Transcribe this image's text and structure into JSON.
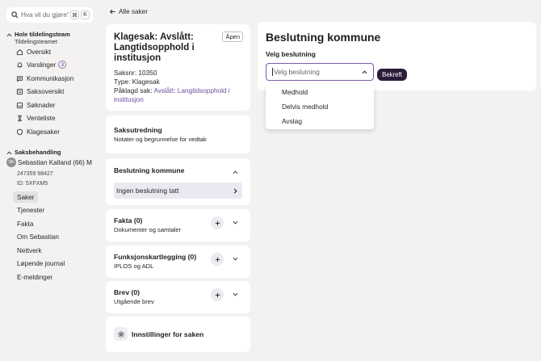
{
  "search": {
    "placeholder": "Hva vil du gjøre?",
    "key1": "⌘",
    "key2": "K"
  },
  "team": {
    "title": "Hole tildelingsteam",
    "subtitle": "Tildelingsteamet",
    "items": [
      {
        "label": "Oversikt",
        "icon": "home-icon"
      },
      {
        "label": "Varslinger",
        "icon": "bell-icon",
        "badge": "3"
      },
      {
        "label": "Kommunikasjon",
        "icon": "chat-icon"
      },
      {
        "label": "Saksoversikt",
        "icon": "list-icon"
      },
      {
        "label": "Søknader",
        "icon": "inbox-icon"
      },
      {
        "label": "Venteliste",
        "icon": "hourglass-icon"
      },
      {
        "label": "Klagesaker",
        "icon": "shield-icon"
      }
    ]
  },
  "casework": {
    "title": "Saksbehandling",
    "avatar": "SK",
    "person": "Sebastian Kalland (66) M",
    "phone": "247359 98427",
    "id": "ID: 5XFXM5",
    "items": [
      "Saker",
      "Tjenester",
      "Fakta",
      "Om Sebastian",
      "Nettverk",
      "Løpende journal",
      "E-meldinger"
    ],
    "active": "Saker"
  },
  "back_link": "Alle saker",
  "case": {
    "title": "Klagesak: Avslått: Langtidsopphold i institusjon",
    "status": "Åpen",
    "number": "Saksnr: 10350",
    "type": "Type: Klagesak",
    "appealed_prefix": "Påklagd sak:",
    "appealed_link": "Avslått: Langtidsopphold i institusjon"
  },
  "saksutredning": {
    "title": "Saksutredning",
    "subtitle": "Notater og begrunnelse for vedtak"
  },
  "beslutning": {
    "title": "Beslutning kommune",
    "row": "Ingen beslutning tatt"
  },
  "fakta": {
    "title": "Fakta (0)",
    "subtitle": "Dokumenter og samtaler"
  },
  "funksjon": {
    "title": "Funksjonskartlegging (0)",
    "subtitle": "IPLOS og ADL"
  },
  "brev": {
    "title": "Brev (0)",
    "subtitle": "Utgående brev"
  },
  "settings": {
    "label": "Innstillinger for saken"
  },
  "decision_panel": {
    "title": "Beslutning kommune",
    "label": "Velg beslutning",
    "placeholder": "Velg beslutning",
    "confirm": "Bekreft",
    "options": [
      "Medhold",
      "Delvis medhold",
      "Avslag"
    ]
  }
}
